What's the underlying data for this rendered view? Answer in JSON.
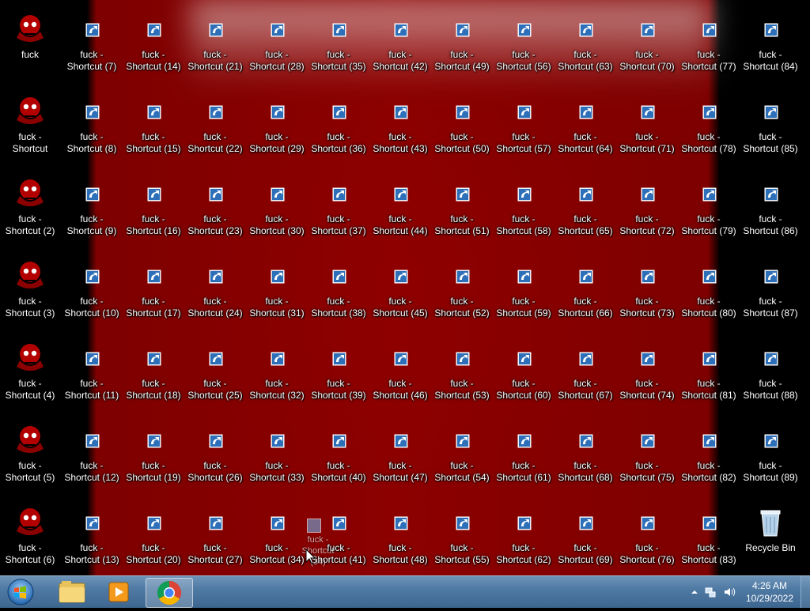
{
  "desktop": {
    "first_icon_label": [
      "fuck",
      ""
    ],
    "shortcut_prefix": "fuck -",
    "shortcut_word": "Shortcut",
    "recycle_bin_label": "Recycle Bin",
    "colors": {
      "accent_red": "#8c0000",
      "shortcut_blue": "#2d6fb8"
    },
    "drag_ghost": {
      "line1": "fuck -",
      "line2": "Shortcut (34)"
    }
  },
  "taskbar": {
    "start_icon": "windows-start-orb-icon",
    "pinned": [
      {
        "name": "windows-explorer",
        "icon": "folder-icon"
      },
      {
        "name": "windows-media-player",
        "icon": "media-player-icon"
      },
      {
        "name": "google-chrome",
        "icon": "chrome-icon",
        "active": true
      }
    ],
    "tray": [
      "show-hidden-icons-icon",
      "network-icon",
      "volume-icon"
    ],
    "time": "4:26 AM",
    "date": "10/29/2022"
  }
}
